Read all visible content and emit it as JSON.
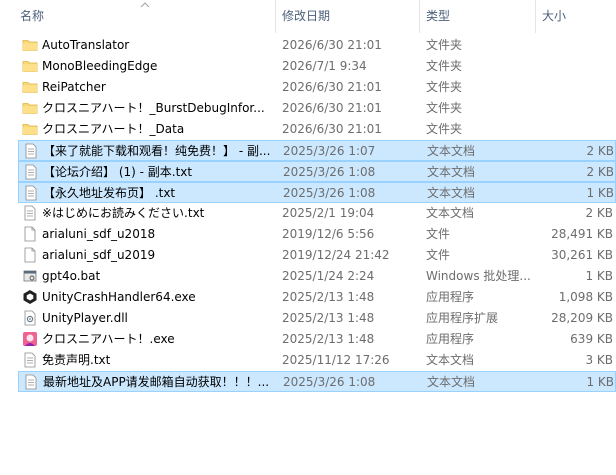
{
  "columns": {
    "name": "名称",
    "date": "修改日期",
    "type": "类型",
    "size": "大小"
  },
  "files": [
    {
      "name": "AutoTranslator",
      "date": "2026/6/30 21:01",
      "type": "文件夹",
      "size": "",
      "icon": "folder-icon",
      "selected": false
    },
    {
      "name": "MonoBleedingEdge",
      "date": "2026/7/1 9:34",
      "type": "文件夹",
      "size": "",
      "icon": "folder-icon",
      "selected": false
    },
    {
      "name": "ReiPatcher",
      "date": "2026/6/30 21:01",
      "type": "文件夹",
      "size": "",
      "icon": "folder-icon",
      "selected": false
    },
    {
      "name": "クロスニアハート！_BurstDebugInfor...",
      "date": "2026/6/30 21:01",
      "type": "文件夹",
      "size": "",
      "icon": "folder-icon",
      "selected": false
    },
    {
      "name": "クロスニアハート！_Data",
      "date": "2026/6/30 21:01",
      "type": "文件夹",
      "size": "",
      "icon": "folder-icon",
      "selected": false
    },
    {
      "name": "【来了就能下载和观看！纯免费！】 - 副...",
      "date": "2025/3/26 1:07",
      "type": "文本文档",
      "size": "2 KB",
      "icon": "text-file-icon",
      "selected": true
    },
    {
      "name": "【论坛介绍】 (1) - 副本.txt",
      "date": "2025/3/26 1:08",
      "type": "文本文档",
      "size": "2 KB",
      "icon": "text-file-icon",
      "selected": true
    },
    {
      "name": "【永久地址发布页】 .txt",
      "date": "2025/3/26 1:08",
      "type": "文本文档",
      "size": "1 KB",
      "icon": "text-file-icon",
      "selected": true
    },
    {
      "name": "※はじめにお読みください.txt",
      "date": "2025/2/1 19:04",
      "type": "文本文档",
      "size": "2 KB",
      "icon": "text-file-icon",
      "selected": false
    },
    {
      "name": "arialuni_sdf_u2018",
      "date": "2019/12/6 5:56",
      "type": "文件",
      "size": "28,491 KB",
      "icon": "blank-file-icon",
      "selected": false
    },
    {
      "name": "arialuni_sdf_u2019",
      "date": "2019/12/24 21:42",
      "type": "文件",
      "size": "30,261 KB",
      "icon": "blank-file-icon",
      "selected": false
    },
    {
      "name": "gpt4o.bat",
      "date": "2025/1/24 2:24",
      "type": "Windows 批处理...",
      "size": "1 KB",
      "icon": "batch-file-icon",
      "selected": false
    },
    {
      "name": "UnityCrashHandler64.exe",
      "date": "2025/2/13 1:48",
      "type": "应用程序",
      "size": "1,098 KB",
      "icon": "unity-icon",
      "selected": false
    },
    {
      "name": "UnityPlayer.dll",
      "date": "2025/2/13 1:48",
      "type": "应用程序扩展",
      "size": "28,209 KB",
      "icon": "dll-file-icon",
      "selected": false
    },
    {
      "name": "クロスニアハート！.exe",
      "date": "2025/2/13 1:48",
      "type": "应用程序",
      "size": "639 KB",
      "icon": "game-app-icon",
      "selected": false
    },
    {
      "name": "免责声明.txt",
      "date": "2025/11/12 17:26",
      "type": "文本文档",
      "size": "3 KB",
      "icon": "text-file-icon",
      "selected": false
    },
    {
      "name": "最新地址及APP请发邮箱自动获取！！！...",
      "date": "2025/3/26 1:08",
      "type": "文本文档",
      "size": "1 KB",
      "icon": "text-file-icon",
      "selected": true
    }
  ]
}
